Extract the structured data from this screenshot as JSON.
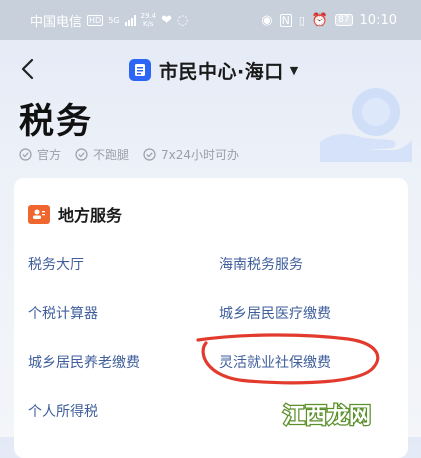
{
  "status_bar": {
    "carrier": "中国电信",
    "hd": "HD",
    "net_type": "5G",
    "net_speed": "29.4",
    "net_speed_unit": "K/s",
    "battery": "87",
    "time": "10:10"
  },
  "header": {
    "back_icon": "chevron-left-icon",
    "city": "市民中心·海口",
    "dropdown_icon": "caret-down-icon"
  },
  "page": {
    "title": "税务",
    "tags": [
      "官方",
      "不跑腿",
      "7x24小时可办"
    ]
  },
  "services_card": {
    "title": "地方服务",
    "items": [
      "税务大厅",
      "海南税务服务",
      "个税计算器",
      "城乡居民医疗缴费",
      "城乡居民养老缴费",
      "灵活就业社保缴费",
      "个人所得税"
    ]
  },
  "annotation": {
    "color": "#e23b2e",
    "circled_item": "灵活就业社保缴费"
  },
  "watermark": {
    "text": "江西龙网"
  },
  "colors": {
    "accent": "#2b66f6",
    "link": "#3f5e9c",
    "card_icon": "#f0662f"
  }
}
